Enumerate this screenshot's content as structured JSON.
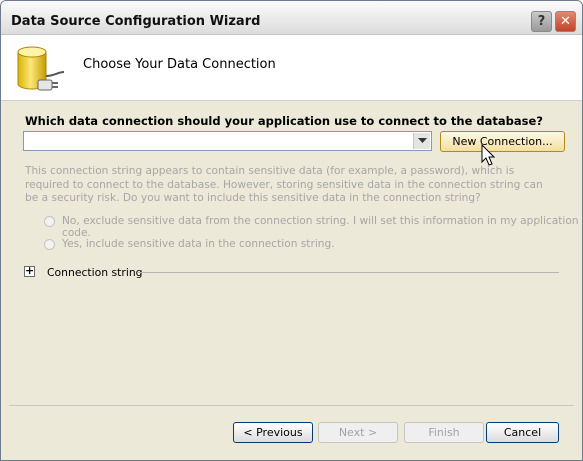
{
  "window": {
    "title": "Data Source Configuration Wizard"
  },
  "titlebar": {
    "help": "?",
    "close": "✕"
  },
  "header": {
    "title": "Choose Your Data Connection"
  },
  "main": {
    "question": "Which data connection should your application use to connect to the database?",
    "connection_value": "",
    "new_connection_label": "New Connection...",
    "sensitive_desc": "This connection string appears to contain sensitive data (for example, a password), which is required to connect to the database. However, storing sensitive data in the connection string can be a security risk. Do you want to include this sensitive data in the connection string?",
    "radio_exclude": "No, exclude sensitive data from the connection string. I will set this information in my application code.",
    "radio_include": "Yes, include sensitive data in the connection string.",
    "expander_symbol": "+",
    "connection_string_label": "Connection string"
  },
  "footer": {
    "previous": "< Previous",
    "next": "Next >",
    "finish": "Finish",
    "cancel": "Cancel"
  }
}
